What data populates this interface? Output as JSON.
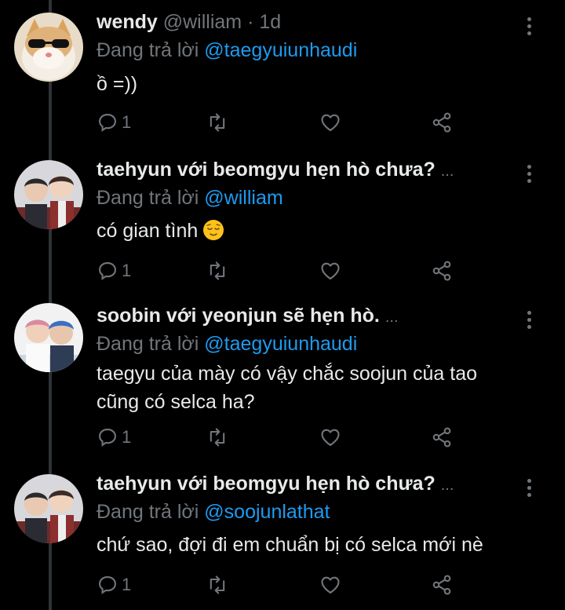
{
  "tweets": [
    {
      "name": "wendy",
      "handle": "@william",
      "separator": "·",
      "time": "1d",
      "reply_prefix": "Đang trả lời",
      "reply_to": "@taegyuiunhaudi",
      "text": "ồ =))",
      "reply_count": "1",
      "avatar_icon": "cat-with-sunglasses-avatar"
    },
    {
      "name": "taehyun với beomgyu hẹn hò chưa?",
      "ellipsis": "...",
      "reply_prefix": "Đang trả lời",
      "reply_to": "@william",
      "text": "có gian tình",
      "emoji_icon": "relieved-face-emoji",
      "reply_count": "1",
      "avatar_icon": "two-people-photo-avatar"
    },
    {
      "name": "soobin với yeonjun sẽ hẹn hò.",
      "ellipsis": "...",
      "reply_prefix": "Đang trả lời",
      "reply_to": "@taegyuiunhaudi",
      "text": "taegyu của mày có vậy chắc soojun của tao cũng có selca ha?",
      "reply_count": "1",
      "avatar_icon": "two-people-selfie-avatar"
    },
    {
      "name": "taehyun với beomgyu hẹn hò chưa?",
      "ellipsis": "...",
      "reply_prefix": "Đang trả lời",
      "reply_to": "@soojunlathat",
      "text": "chứ sao, đợi đi em chuẩn bị có selca mới nè",
      "reply_count": "1",
      "avatar_icon": "two-people-photo-avatar"
    }
  ],
  "colors": {
    "background": "#000000",
    "primary_text": "#e7e9ea",
    "secondary_text": "#71767b",
    "link": "#1d9bf0",
    "thread_line": "#2f3336"
  },
  "icons": [
    "reply-icon",
    "retweet-icon",
    "like-icon",
    "share-icon",
    "more-options-icon"
  ]
}
